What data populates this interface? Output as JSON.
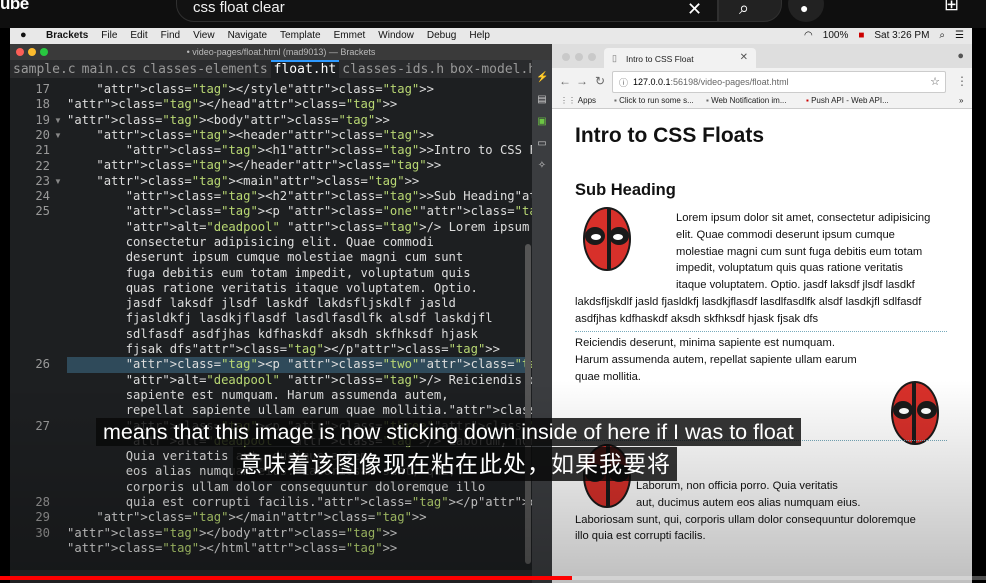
{
  "youtube": {
    "logo": "ube",
    "search_text": "css float clear"
  },
  "menubar": {
    "items": [
      "Brackets",
      "File",
      "Edit",
      "Find",
      "View",
      "Navigate",
      "Template",
      "Emmet",
      "Window",
      "Debug",
      "Help"
    ],
    "battery": "100%",
    "datetime": "Sat 3:26 PM"
  },
  "brackets": {
    "window_title": "• video-pages/float.html (mad9013) — Brackets",
    "tabs": [
      "sample.c",
      "main.cs",
      "classes-elements",
      "float.ht",
      "classes-ids.h",
      "box-model.h"
    ],
    "active_tab": 3,
    "line_numbers": [
      "17",
      "18",
      "19",
      "20",
      "21",
      "22",
      "23",
      "24",
      "25",
      "",
      "",
      "",
      "",
      "",
      "",
      "",
      "",
      "",
      "26",
      "",
      "",
      "",
      "27",
      "",
      "",
      "",
      "",
      "28",
      "29",
      "30"
    ],
    "code_lines": [
      "    </style>",
      "</head>",
      "<body>",
      "    <header>",
      "        <h1>Intro to CSS Floats</h1>",
      "    </header>",
      "    <main>",
      "        <h2>Sub Heading</h2>",
      "        <p class=\"one\"><img src=\"avatar.png\"",
      "        alt=\"deadpool\" /> Lorem ipsum dolor sit amet,",
      "        consectetur adipisicing elit. Quae commodi",
      "        deserunt ipsum cumque molestiae magni cum sunt",
      "        fuga debitis eum totam impedit, voluptatum quis",
      "        quas ratione veritatis itaque voluptatem. Optio.",
      "        jasdf laksdf jlsdf laskdf lakdsfljskdlf jasld",
      "        fjasldkfj lasdkjflasdf lasdlfasdlfk alsdf laskdjfl",
      "        sdlfasdf asdfjhas kdfhaskdf aksdh skfhksdf hjask",
      "        fjsak dfs</p>",
      "        <p class=\"two\"><img src=\"avatar.png\"",
      "        alt=\"deadpool\" /> Reiciendis deserunt, minima",
      "        sapiente est numquam. Harum assumenda autem,",
      "        repellat sapiente ullam earum quae mollitia.</p>",
      "        <p class=\"three\"><img src=\"avatar.png\"",
      "        alt=\"deadpool\" /> Laborum, non officia porro.",
      "        Quia veritatis aut, ducimus autem",
      "        eos alias numquam eius. Laboriosam sunt, qui,",
      "        corporis ullam dolor consequuntur doloremque illo",
      "        quia est corrupti facilis.</p>",
      "    </main>",
      "</body>",
      "</html>"
    ]
  },
  "chrome": {
    "tab_title": "Intro to CSS Float",
    "url_host": "127.0.0.1",
    "url_rest": ":56198/video-pages/float.html",
    "bookmarks": [
      "Apps",
      "Click to run some s...",
      "Web Notification im...",
      "Push API - Web API..."
    ],
    "page": {
      "h1": "Intro to CSS Floats",
      "h2": "Sub Heading",
      "p1_lines": [
        "Lorem ipsum dolor sit amet, consectetur adipisicing",
        "elit. Quae commodi deserunt ipsum cumque",
        "molestiae magni cum sunt fuga debitis eum totam",
        "impedit, voluptatum quis quas ratione veritatis",
        "itaque voluptatem. Optio. jasdf laksdf jlsdf lasdkf"
      ],
      "p1_wrap": [
        "lakdsfljskdlf jasld fjasldkfj lasdkjflasdf lasdlfasdlfk alsdf lasdkjfl sdlfasdf",
        "asdfjhas kdfhaskdf aksdh skfhksdf hjask fjsak dfs"
      ],
      "p2_lines": [
        "Reiciendis deserunt, minima sapiente est numquam.",
        "Harum assumenda autem, repellat sapiente ullam earum",
        "quae mollitia."
      ],
      "p3_lines": [
        "Laborum, non officia porro. Quia veritatis",
        "aut, ducimus autem eos alias numquam eius.",
        "Laboriosam sunt, qui, corporis ullam dolor consequuntur doloremque",
        "illo quia est corrupti facilis."
      ]
    }
  },
  "subtitles": {
    "english": "means that this image is now sticking down inside of here if I was to float",
    "chinese": "意味着该图像现在粘在此处，如果我要将"
  },
  "progress": {
    "fraction": 0.58
  },
  "colors": {
    "accent": "#2e9aff",
    "progress": "#ff0000"
  }
}
